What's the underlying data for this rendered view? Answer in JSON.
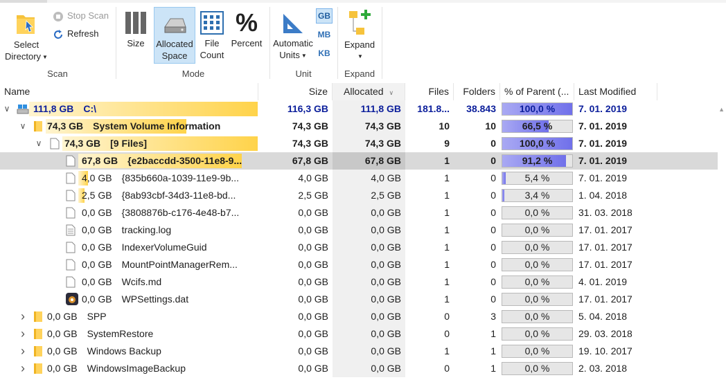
{
  "ribbon": {
    "scan": {
      "select_directory": "Select",
      "select_directory_2": "Directory",
      "stop_scan": "Stop Scan",
      "refresh": "Refresh",
      "group": "Scan"
    },
    "mode": {
      "size": "Size",
      "allocated": "Allocated",
      "allocated_2": "Space",
      "file_count": "File",
      "file_count_2": "Count",
      "percent": "Percent",
      "group": "Mode"
    },
    "unit": {
      "automatic": "Automatic",
      "automatic_2": "Units",
      "gb": "GB",
      "mb": "MB",
      "kb": "KB",
      "group": "Unit"
    },
    "expand": {
      "expand": "Expand",
      "group": "Expand"
    }
  },
  "columns": {
    "name": "Name",
    "size": "Size",
    "allocated": "Allocated",
    "files": "Files",
    "folders": "Folders",
    "percent": "% of Parent (...",
    "modified": "Last Modified"
  },
  "rows": [
    {
      "depth": 0,
      "chev": "down",
      "icon": "drive",
      "size_label": "111,8 GB",
      "name": "C:\\",
      "size": "116,3 GB",
      "alloc": "111,8 GB",
      "files": "181.8...",
      "folders": "38.843",
      "pct": "100,0 %",
      "pctv": 100,
      "mod": "7. 01. 2019",
      "bold": true,
      "blue": true,
      "bar": 1.0
    },
    {
      "depth": 1,
      "chev": "down",
      "icon": "folder",
      "size_label": "74,3 GB",
      "name": "System Volume Information",
      "size": "74,3 GB",
      "alloc": "74,3 GB",
      "files": "10",
      "folders": "10",
      "pct": "66,5 %",
      "pctv": 66.5,
      "mod": "7. 01. 2019",
      "bold": true,
      "bar": 0.665
    },
    {
      "depth": 2,
      "chev": "down",
      "icon": "file",
      "size_label": "74,3 GB",
      "name": "[9 Files]",
      "size": "74,3 GB",
      "alloc": "74,3 GB",
      "files": "9",
      "folders": "0",
      "pct": "100,0 %",
      "pctv": 100,
      "mod": "7. 01. 2019",
      "bold": true,
      "bar": 1.0
    },
    {
      "depth": 3,
      "chev": "",
      "icon": "file",
      "size_label": "67,8 GB",
      "name": "{e2baccdd-3500-11e8-9...",
      "size": "67,8 GB",
      "alloc": "67,8 GB",
      "files": "1",
      "folders": "0",
      "pct": "91,2 %",
      "pctv": 91.2,
      "mod": "7. 01. 2019",
      "bold": true,
      "selected": true,
      "bar": 0.912
    },
    {
      "depth": 3,
      "chev": "",
      "icon": "file",
      "size_label": "4,0 GB",
      "name": "{835b660a-1039-11e9-9b...",
      "size": "4,0 GB",
      "alloc": "4,0 GB",
      "files": "1",
      "folders": "0",
      "pct": "5,4 %",
      "pctv": 5.4,
      "mod": "7. 01. 2019",
      "bar": 0.054
    },
    {
      "depth": 3,
      "chev": "",
      "icon": "file",
      "size_label": "2,5 GB",
      "name": "{8ab93cbf-34d3-11e8-bd...",
      "size": "2,5 GB",
      "alloc": "2,5 GB",
      "files": "1",
      "folders": "0",
      "pct": "3,4 %",
      "pctv": 3.4,
      "mod": "1. 04. 2018",
      "bar": 0.034
    },
    {
      "depth": 3,
      "chev": "",
      "icon": "file",
      "size_label": "0,0 GB",
      "name": "{3808876b-c176-4e48-b7...",
      "size": "0,0 GB",
      "alloc": "0,0 GB",
      "files": "1",
      "folders": "0",
      "pct": "0,0 %",
      "pctv": 0,
      "mod": "31. 03. 2018",
      "bar": 0
    },
    {
      "depth": 3,
      "chev": "",
      "icon": "text-file",
      "size_label": "0,0 GB",
      "name": "tracking.log",
      "size": "0,0 GB",
      "alloc": "0,0 GB",
      "files": "1",
      "folders": "0",
      "pct": "0,0 %",
      "pctv": 0,
      "mod": "17. 01. 2017",
      "bar": 0
    },
    {
      "depth": 3,
      "chev": "",
      "icon": "file",
      "size_label": "0,0 GB",
      "name": "IndexerVolumeGuid",
      "size": "0,0 GB",
      "alloc": "0,0 GB",
      "files": "1",
      "folders": "0",
      "pct": "0,0 %",
      "pctv": 0,
      "mod": "17. 01. 2017",
      "bar": 0
    },
    {
      "depth": 3,
      "chev": "",
      "icon": "file",
      "size_label": "0,0 GB",
      "name": "MountPointManagerRem...",
      "size": "0,0 GB",
      "alloc": "0,0 GB",
      "files": "1",
      "folders": "0",
      "pct": "0,0 %",
      "pctv": 0,
      "mod": "17. 01. 2017",
      "bar": 0
    },
    {
      "depth": 3,
      "chev": "",
      "icon": "file",
      "size_label": "0,0 GB",
      "name": "Wcifs.md",
      "size": "0,0 GB",
      "alloc": "0,0 GB",
      "files": "1",
      "folders": "0",
      "pct": "0,0 %",
      "pctv": 0,
      "mod": "4. 01. 2019",
      "bar": 0
    },
    {
      "depth": 3,
      "chev": "",
      "icon": "settings-file",
      "size_label": "0,0 GB",
      "name": "WPSettings.dat",
      "size": "0,0 GB",
      "alloc": "0,0 GB",
      "files": "1",
      "folders": "0",
      "pct": "0,0 %",
      "pctv": 0,
      "mod": "17. 01. 2017",
      "bar": 0
    },
    {
      "depth": 1,
      "chev": "right",
      "icon": "folder",
      "size_label": "0,0 GB",
      "name": "SPP",
      "size": "0,0 GB",
      "alloc": "0,0 GB",
      "files": "0",
      "folders": "3",
      "pct": "0,0 %",
      "pctv": 0,
      "mod": "5. 04. 2018",
      "bar": 0
    },
    {
      "depth": 1,
      "chev": "right",
      "icon": "folder",
      "size_label": "0,0 GB",
      "name": "SystemRestore",
      "size": "0,0 GB",
      "alloc": "0,0 GB",
      "files": "0",
      "folders": "1",
      "pct": "0,0 %",
      "pctv": 0,
      "mod": "29. 03. 2018",
      "bar": 0
    },
    {
      "depth": 1,
      "chev": "right",
      "icon": "folder",
      "size_label": "0,0 GB",
      "name": "Windows Backup",
      "size": "0,0 GB",
      "alloc": "0,0 GB",
      "files": "1",
      "folders": "1",
      "pct": "0,0 %",
      "pctv": 0,
      "mod": "19. 10. 2017",
      "bar": 0
    },
    {
      "depth": 1,
      "chev": "right",
      "icon": "folder",
      "size_label": "0,0 GB",
      "name": "WindowsImageBackup",
      "size": "0,0 GB",
      "alloc": "0,0 GB",
      "files": "0",
      "folders": "1",
      "pct": "0,0 %",
      "pctv": 0,
      "mod": "2. 03. 2018",
      "bar": 0
    }
  ]
}
